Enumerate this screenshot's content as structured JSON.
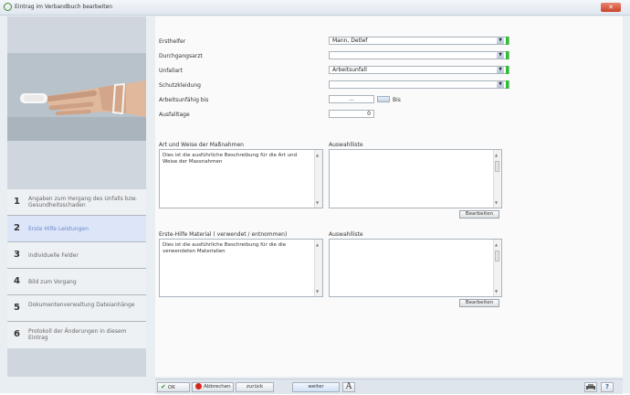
{
  "window": {
    "title": "Eintrag im Verbandbuch bearbeiten",
    "close": "✕"
  },
  "form": {
    "ersthelfer": {
      "label": "Ersthelfer",
      "value": "Mann, Detlef"
    },
    "durchgangsarzt": {
      "label": "Durchgangsarzt",
      "value": ""
    },
    "unfallart": {
      "label": "Unfallart",
      "value": "Arbeitsunfall"
    },
    "schutzkleidung": {
      "label": "Schutzkleidung",
      "value": ""
    },
    "arbeitsunfaehig": {
      "label": "Arbeitsunfähig bis",
      "value": "...",
      "bis": "Bis"
    },
    "ausfalltage": {
      "label": "Ausfalltage",
      "value": "0"
    }
  },
  "section1": {
    "label": "Art und Weise der Maßnahmen",
    "text": "Dies ist die ausführliche Beschreibung für die Art und Weise der Massnahmen",
    "list_label": "Auswahlliste",
    "edit_button": "Bearbeiten"
  },
  "section2": {
    "label": "Erste-Hilfe Material ( verwendet / entnommen)",
    "text": "Dies ist die ausführliche Beschreibung für die die verwendeten Materialien",
    "list_label": "Auswahlliste",
    "edit_button": "Bearbeiten"
  },
  "steps": [
    {
      "num": "1",
      "label": "Angaben zum Hergang des Unfalls bzw. Gesundheitsschaden"
    },
    {
      "num": "2",
      "label": "Erste Hilfe Leistungen"
    },
    {
      "num": "3",
      "label": "individuelle Felder"
    },
    {
      "num": "4",
      "label": "Bild zum Vorgang"
    },
    {
      "num": "5",
      "label": "Dokumentenverwaltung Dateianhänge"
    },
    {
      "num": "6",
      "label": "Protokoll der Änderungen in diesem Eintrag"
    }
  ],
  "toolbar": {
    "ok": "OK",
    "abbrechen": "Abbrechen",
    "zurueck": "zurück",
    "weiter": "weiter",
    "font_icon": "A",
    "print_icon": "printer-icon",
    "help_icon": "help-icon"
  },
  "colors": {
    "required_marker": "#26c426",
    "active_step": "#dde6f8",
    "cancel_red": "#d9261c",
    "ok_green": "#2f9e2f"
  }
}
